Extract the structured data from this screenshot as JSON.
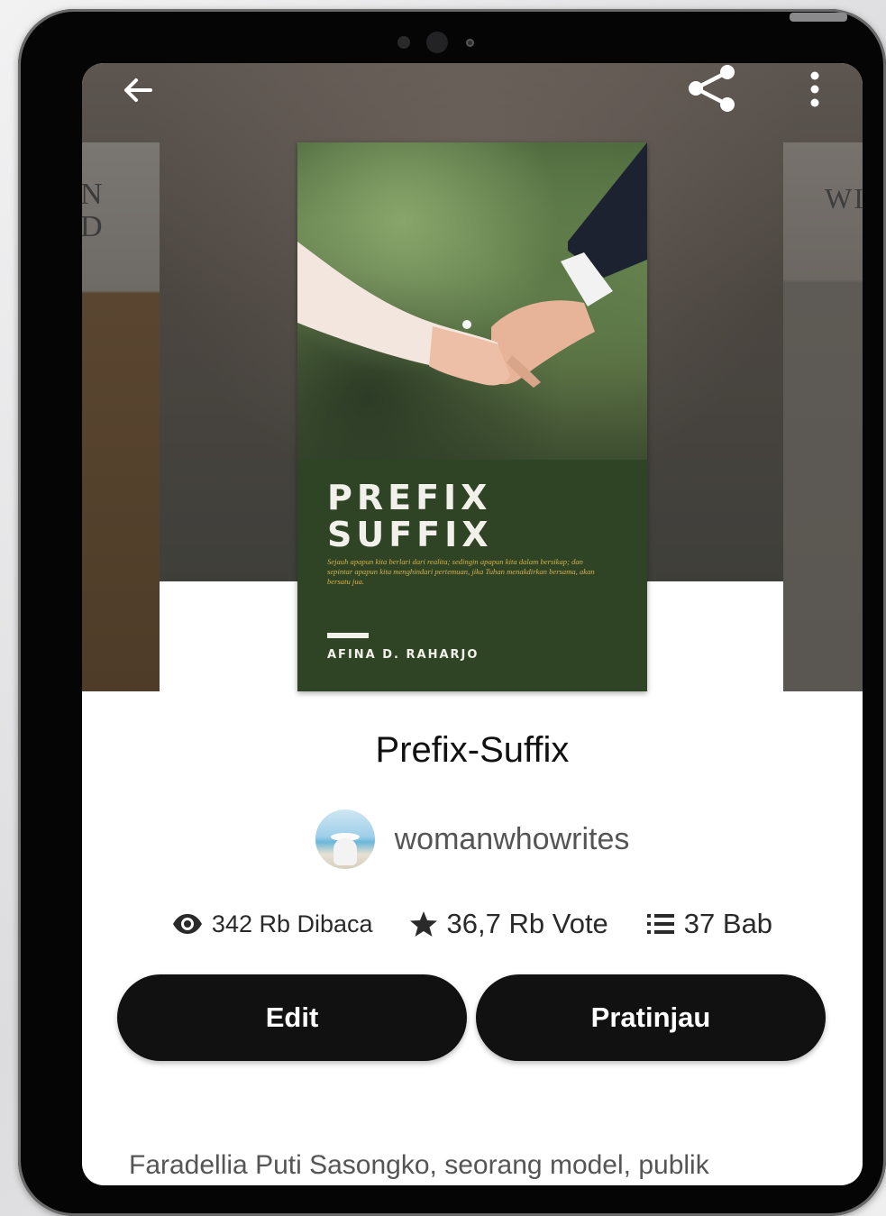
{
  "cover": {
    "title_line1": "PREFIX",
    "title_line2": "SUFFIX",
    "tagline": "Sejauh apapun kita berlari dari realita; sedingin apapun kita dalam bersikap; dan sepintar apapun kita menghindari pertemuan, jika Tuhan menakdirkan bersama, akan bersatu jua.",
    "author": "AFINA D. RAHARJO"
  },
  "side_covers": {
    "left_text_line1": "N",
    "left_text_line2": "D",
    "right_text": "WI"
  },
  "book": {
    "title": "Prefix-Suffix",
    "author_username": "womanwhowrites"
  },
  "stats": {
    "views": "342 Rb Dibaca",
    "votes": "36,7 Rb Vote",
    "chapters": "37 Bab"
  },
  "actions": {
    "edit_label": "Edit",
    "preview_label": "Pratinjau"
  },
  "synopsis": {
    "text": "Faradellia Puti Sasongko, seorang model, publik"
  },
  "icons": {
    "back": "arrow-left-icon",
    "share": "share-icon",
    "more": "more-vertical-icon",
    "views": "eye-icon",
    "votes": "star-icon",
    "chapters": "list-icon"
  },
  "colors": {
    "button_bg": "#111111",
    "cover_panel": "#2f4424",
    "cover_tagline": "#d6b24a"
  }
}
